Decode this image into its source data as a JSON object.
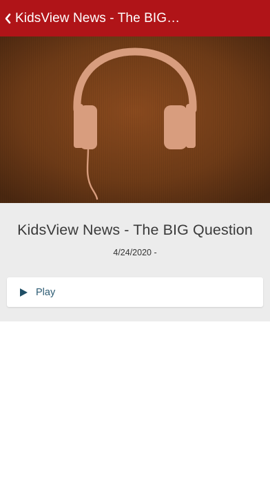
{
  "navbar": {
    "title": "KidsView News - The BIG…",
    "back_icon": "chevron-left-icon",
    "background_color": "#b01418"
  },
  "hero": {
    "image_subject": "headphones",
    "background_color": "#7a4018",
    "graphic_color": "#d89d7e"
  },
  "episode": {
    "title": "KidsView News - The BIG Question",
    "date": "4/24/2020 -"
  },
  "player": {
    "play_label": "Play",
    "play_icon": "play-icon",
    "accent_color": "#1f4e66"
  }
}
